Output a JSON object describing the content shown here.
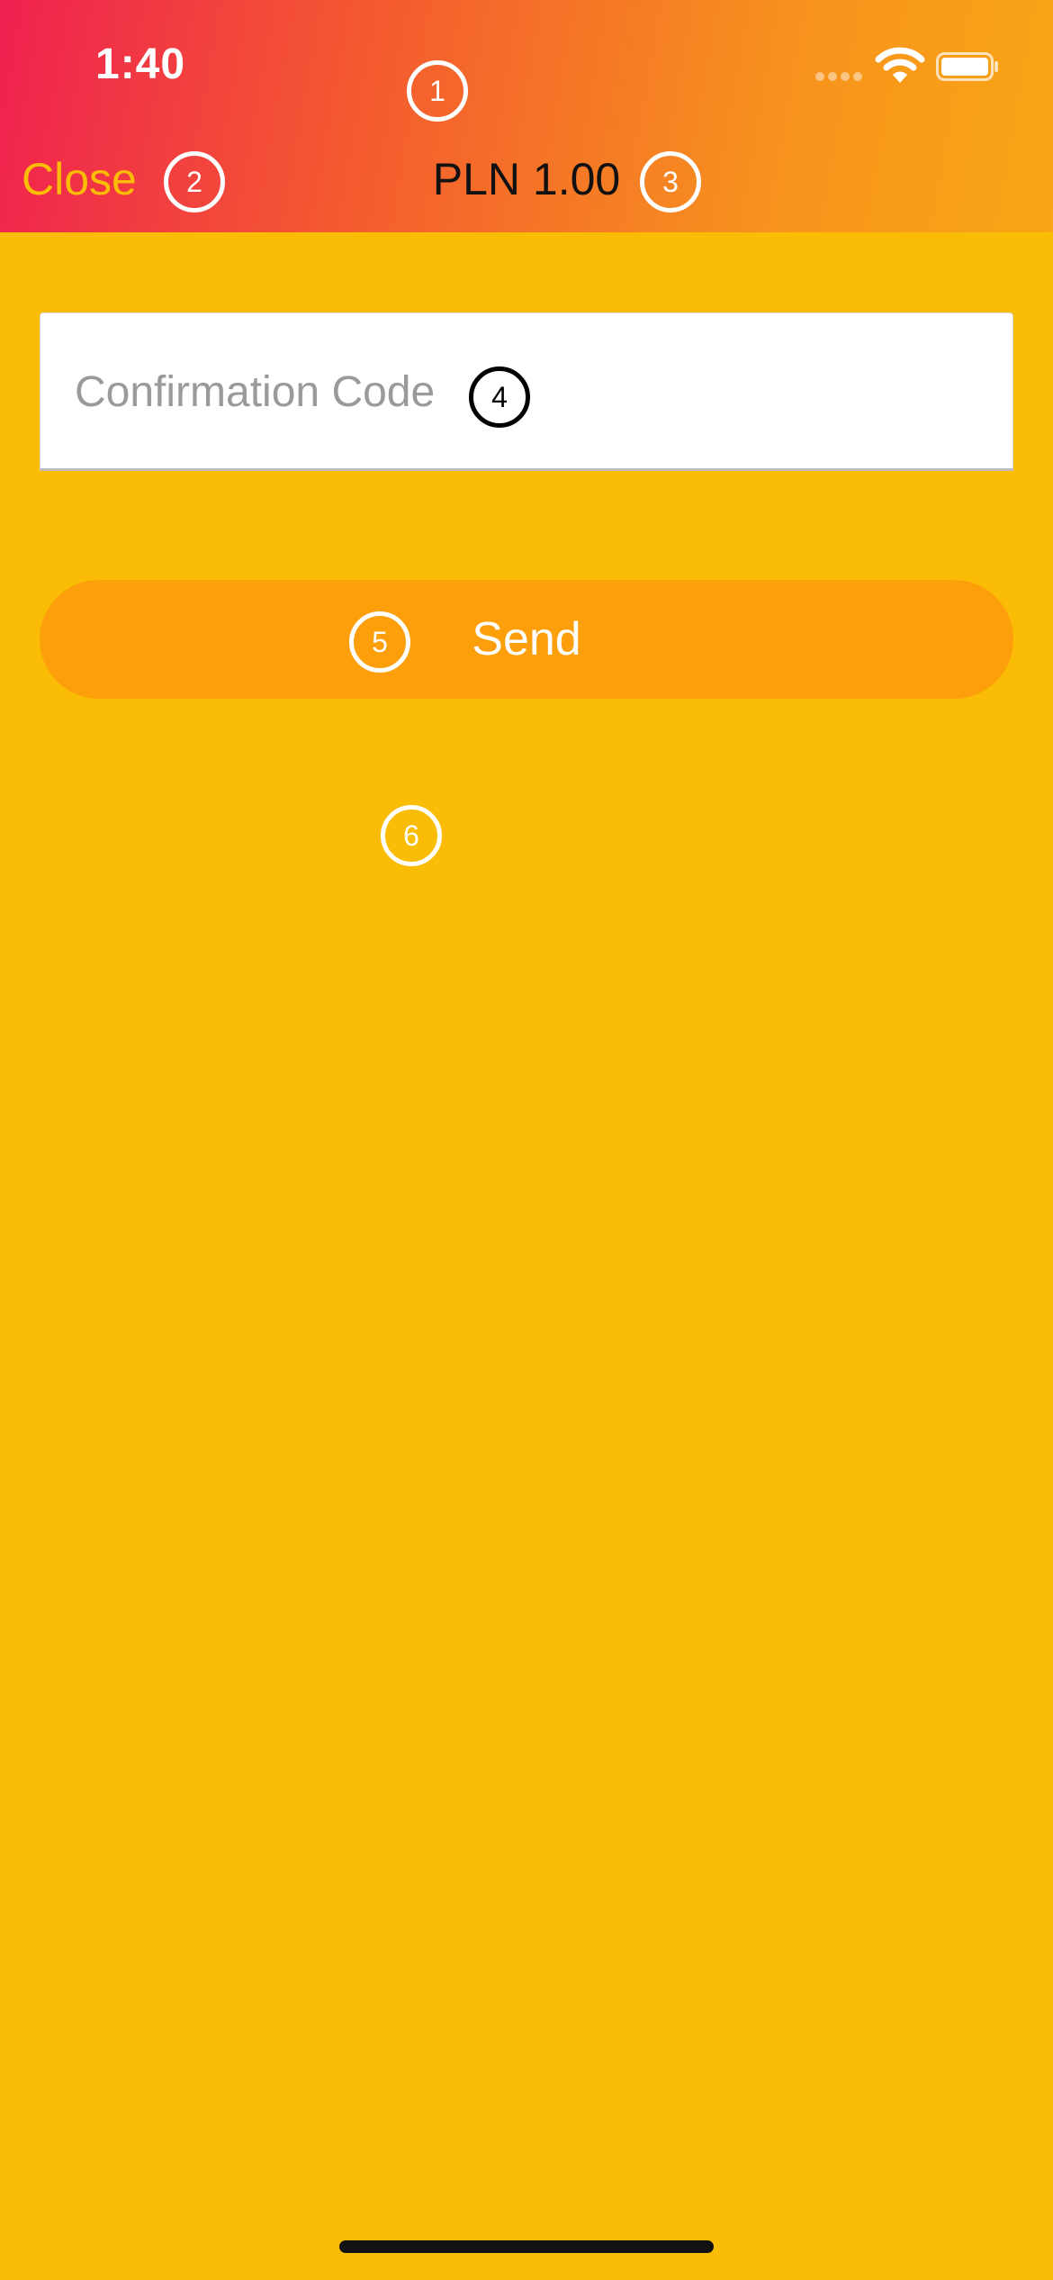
{
  "status_bar": {
    "time": "1:40",
    "signal_icon": "cellular-signal-icon",
    "wifi_icon": "wifi-icon",
    "battery_icon": "battery-icon"
  },
  "nav": {
    "close_label": "Close",
    "title": "PLN 1.00"
  },
  "form": {
    "code_placeholder": "Confirmation Code",
    "code_value": "",
    "send_label": "Send"
  },
  "markers": [
    "1",
    "2",
    "3",
    "4",
    "5",
    "6"
  ],
  "colors": {
    "background": "#FBBC05",
    "header_gradient_start": "#EF2150",
    "header_gradient_end": "#F9A515",
    "button": "#FD9E0B",
    "close_text": "#FBBC05"
  }
}
